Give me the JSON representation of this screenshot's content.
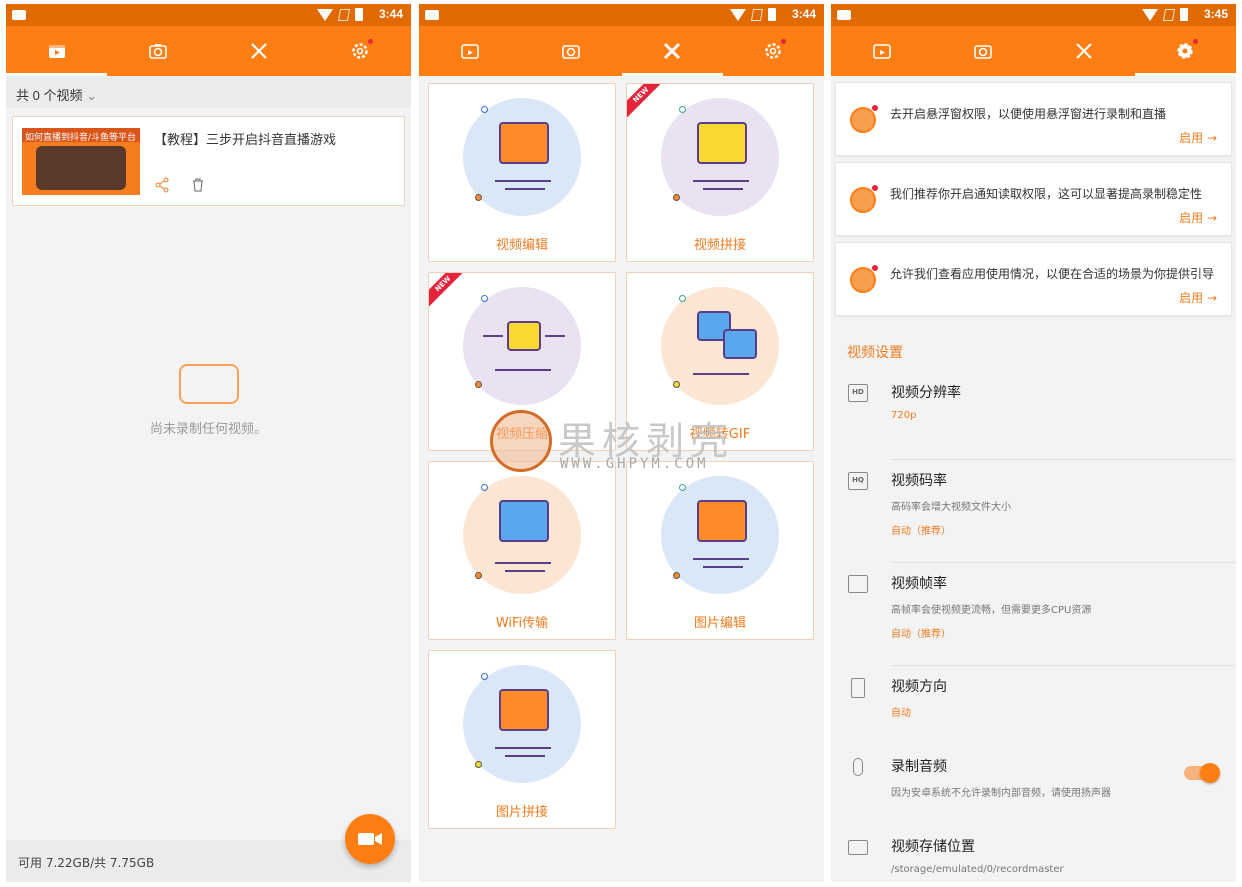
{
  "panel1": {
    "status": {
      "time": "3:44"
    },
    "count_label": "共 0 个视频",
    "video": {
      "title": "【教程】三步开启抖音直播游戏",
      "thumb_text": "如何直播到抖音/斗鱼等平台"
    },
    "empty_text": "尚未录制任何视频。",
    "footer_storage": "可用 7.22GB/共 7.75GB"
  },
  "panel2": {
    "status": {
      "time": "3:44"
    },
    "tools": [
      {
        "label": "视频编辑",
        "new": false
      },
      {
        "label": "视频拼接",
        "new": true
      },
      {
        "label": "视频压缩",
        "new": true
      },
      {
        "label": "视频转GIF",
        "new": false
      },
      {
        "label": "WiFi传输",
        "new": false
      },
      {
        "label": "图片编辑",
        "new": false
      },
      {
        "label": "图片拼接",
        "new": false
      }
    ],
    "new_badge": "NEW"
  },
  "panel3": {
    "status": {
      "time": "3:45"
    },
    "permissions": [
      {
        "text": "去开启悬浮窗权限，以便使用悬浮窗进行录制和直播",
        "action": "启用 →"
      },
      {
        "text": "我们推荐你开启通知读取权限，这可以显著提高录制稳定性",
        "action": "启用 →"
      },
      {
        "text": "允许我们查看应用使用情况，以便在合适的场景为你提供引导",
        "action": "启用 →"
      }
    ],
    "section_title": "视频设置",
    "settings": [
      {
        "icon": "HD",
        "title": "视频分辨率",
        "desc": "",
        "value": "720p"
      },
      {
        "icon": "HQ",
        "title": "视频码率",
        "desc": "高码率会增大视频文件大小",
        "value": "自动（推荐）"
      },
      {
        "icon": "",
        "title": "视频帧率",
        "desc": "高帧率会使视频更流畅，但需要更多CPU资源",
        "value": "自动（推荐）"
      },
      {
        "icon": "",
        "title": "视频方向",
        "desc": "",
        "value": "自动"
      },
      {
        "icon": "",
        "title": "录制音频",
        "desc": "因为安卓系统不允许录制内部音频，请使用扬声器",
        "value": ""
      },
      {
        "icon": "",
        "title": "视频存储位置",
        "desc": "/storage/emulated/0/recordmaster",
        "value": ""
      }
    ]
  },
  "watermark": {
    "cn": "果核剥壳",
    "en": "WWW.GHPYM.COM"
  },
  "colors": {
    "accent": "#ff7e14",
    "status": "#e06a00",
    "label": "#f07c21"
  }
}
